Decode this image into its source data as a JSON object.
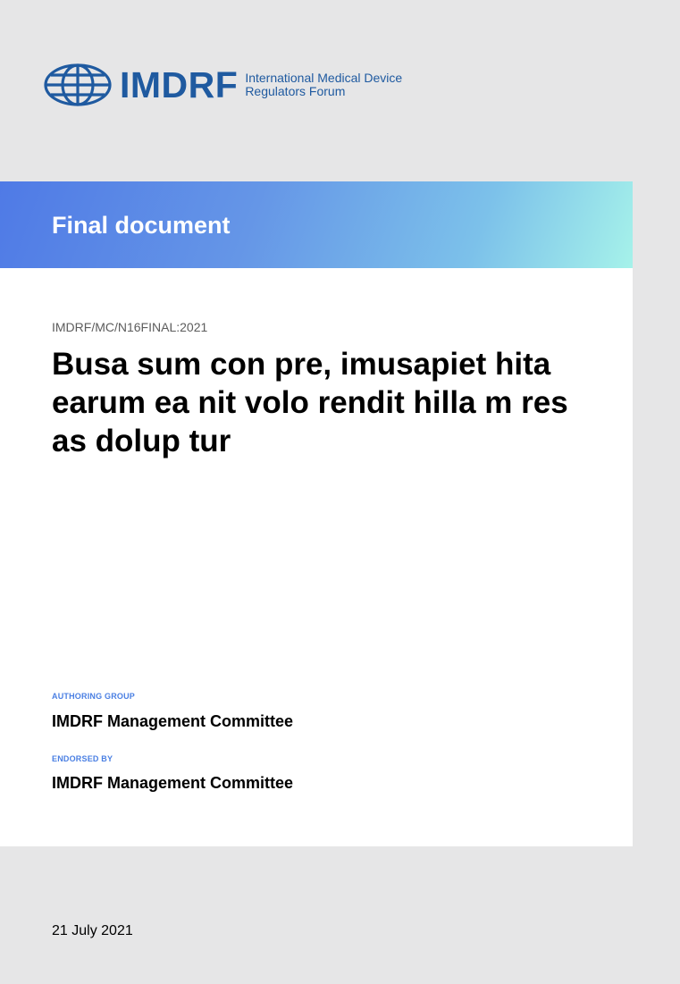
{
  "header": {
    "logo_wordmark": "IMDRF",
    "logo_subtitle_line1": "International Medical Device",
    "logo_subtitle_line2": "Regulators Forum",
    "logo_icon": "globe-icon",
    "brand_color": "#1f5aa0"
  },
  "banner": {
    "title": "Final document",
    "gradient_colors": [
      "#4f7ae6",
      "#7cc1ea",
      "#a6f2ea"
    ]
  },
  "document": {
    "code": "IMDRF/MC/N16FINAL:2021",
    "title": "Busa sum con pre, imusapiet hita earum ea nit volo rendit hilla m res as dolup tur"
  },
  "authoring": {
    "label": "AUTHORING GROUP",
    "value": "IMDRF Management Committee"
  },
  "endorsed": {
    "label": "ENDORSED BY",
    "value": "IMDRF Management Committee"
  },
  "footer": {
    "date": "21 July 2021"
  },
  "colors": {
    "accent_label": "#4a7fe3",
    "page_background": "#e6e6e7",
    "card_background": "#ffffff"
  }
}
